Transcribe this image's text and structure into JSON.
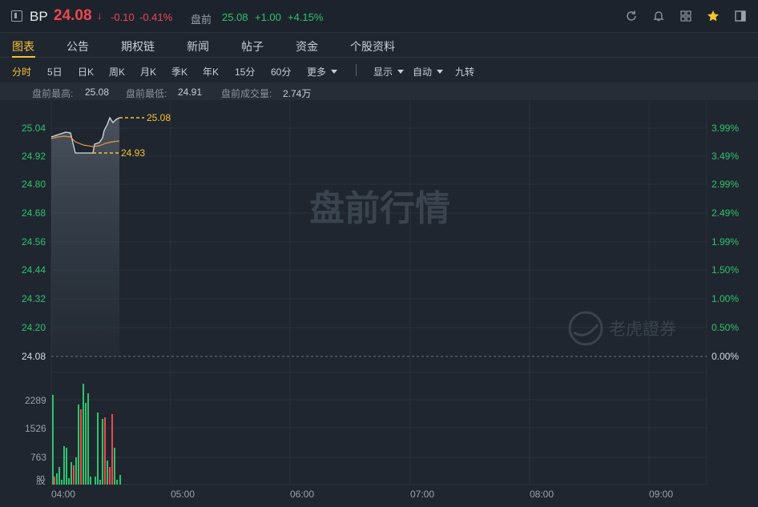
{
  "header": {
    "symbol": "BP",
    "price": "24.08",
    "arrow": "↓",
    "change": "-0.10",
    "change_pct": "-0.41%",
    "premarket_label": "盘前",
    "premarket_price": "25.08",
    "premarket_change": "+1.00",
    "premarket_change_pct": "+4.15%",
    "icons": [
      "refresh-icon",
      "bell-icon",
      "grid-icon",
      "star-icon",
      "panel-icon"
    ]
  },
  "tabs": [
    {
      "label": "图表",
      "active": true
    },
    {
      "label": "公告"
    },
    {
      "label": "期权链"
    },
    {
      "label": "新闻"
    },
    {
      "label": "帖子"
    },
    {
      "label": "资金"
    },
    {
      "label": "个股资料"
    }
  ],
  "periods": [
    {
      "label": "分时",
      "active": true
    },
    {
      "label": "5日"
    },
    {
      "label": "日K"
    },
    {
      "label": "周K"
    },
    {
      "label": "月K"
    },
    {
      "label": "季K"
    },
    {
      "label": "年K"
    },
    {
      "label": "15分"
    },
    {
      "label": "60分"
    },
    {
      "label": "更多"
    }
  ],
  "options": {
    "display": "显示",
    "auto": "自动",
    "nine": "九转"
  },
  "stats": {
    "high_label": "盘前最高:",
    "high": "25.08",
    "low_label": "盘前最低:",
    "low": "24.91",
    "vol_label": "盘前成交量:",
    "vol": "2.74万"
  },
  "chart": {
    "watermark": "盘前行情",
    "brand": "老虎證券",
    "price_ticks": [
      "25.04",
      "24.92",
      "24.80",
      "24.68",
      "24.56",
      "24.44",
      "24.32",
      "24.20",
      "24.08"
    ],
    "pct_ticks": [
      "3.99%",
      "3.49%",
      "2.99%",
      "2.49%",
      "1.99%",
      "1.50%",
      "1.00%",
      "0.50%",
      "0.00%"
    ],
    "vol_ticks": [
      "2289",
      "1526",
      "763"
    ],
    "vol_unit": "股",
    "time_ticks": [
      "04:00",
      "05:00",
      "06:00",
      "07:00",
      "08:00",
      "09:00"
    ],
    "high_marker": "25.08",
    "low_marker": "24.93",
    "colors": {
      "up": "#2fc46a",
      "down": "#f0474f",
      "accent": "#f5c22d",
      "avg": "#e8963c"
    }
  }
}
